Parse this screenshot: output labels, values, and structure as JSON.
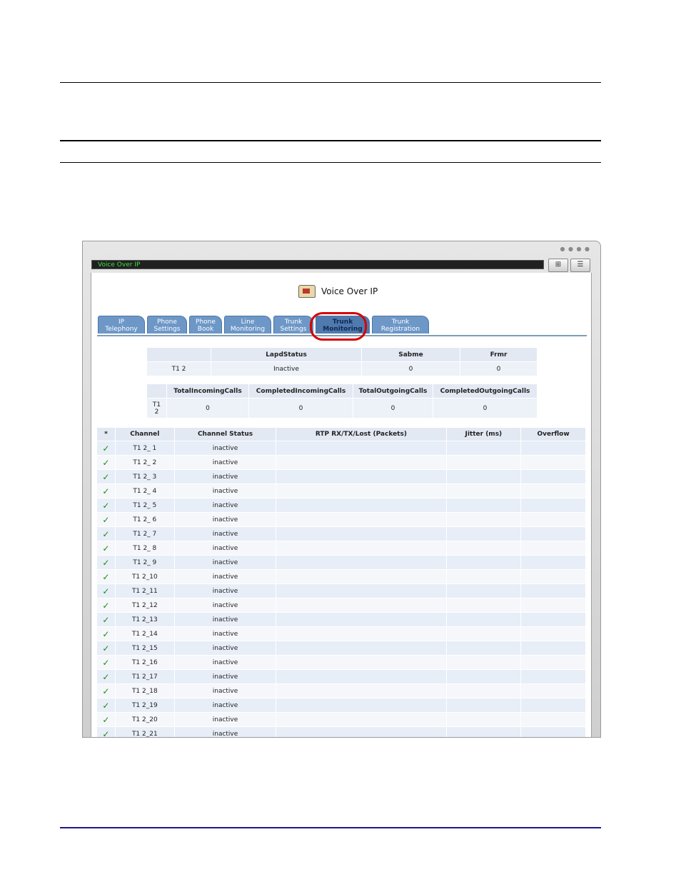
{
  "window": {
    "address": "Voice Over IP",
    "page_title": "Voice Over IP",
    "icons": [
      "phone-icon",
      "network-map-icon",
      "menu-list-icon"
    ]
  },
  "tabs": [
    {
      "line1": "IP",
      "line2": "Telephony"
    },
    {
      "line1": "Phone",
      "line2": "Settings"
    },
    {
      "line1": "Phone",
      "line2": "Book"
    },
    {
      "line1": "Line",
      "line2": "Monitoring"
    },
    {
      "line1": "Trunk",
      "line2": "Settings"
    },
    {
      "line1": "Trunk",
      "line2": "Monitoring",
      "active": true
    },
    {
      "line1": "Trunk",
      "line2": "Registration"
    }
  ],
  "status_table": {
    "headers": [
      "",
      "LapdStatus",
      "Sabme",
      "Frmr"
    ],
    "row": [
      "T1 2",
      "Inactive",
      "0",
      "0"
    ]
  },
  "calls_table": {
    "headers": [
      "",
      "TotalIncomingCalls",
      "CompletedIncomingCalls",
      "TotalOutgoingCalls",
      "CompletedOutgoingCalls"
    ],
    "row_label_1": "T1",
    "row_label_2": "2",
    "values": [
      "0",
      "0",
      "0",
      "0"
    ]
  },
  "channel_table": {
    "headers": [
      "*",
      "Channel",
      "Channel Status",
      "RTP RX/TX/Lost (Packets)",
      "Jitter (ms)",
      "Overflow"
    ],
    "check_glyph": "✓",
    "rows": [
      {
        "channel": "T1 2_ 1",
        "status": "inactive"
      },
      {
        "channel": "T1 2_ 2",
        "status": "inactive"
      },
      {
        "channel": "T1 2_ 3",
        "status": "inactive"
      },
      {
        "channel": "T1 2_ 4",
        "status": "inactive"
      },
      {
        "channel": "T1 2_ 5",
        "status": "inactive"
      },
      {
        "channel": "T1 2_ 6",
        "status": "inactive"
      },
      {
        "channel": "T1 2_ 7",
        "status": "inactive"
      },
      {
        "channel": "T1 2_ 8",
        "status": "inactive"
      },
      {
        "channel": "T1 2_ 9",
        "status": "inactive"
      },
      {
        "channel": "T1 2_10",
        "status": "inactive"
      },
      {
        "channel": "T1 2_11",
        "status": "inactive"
      },
      {
        "channel": "T1 2_12",
        "status": "inactive"
      },
      {
        "channel": "T1 2_13",
        "status": "inactive"
      },
      {
        "channel": "T1 2_14",
        "status": "inactive"
      },
      {
        "channel": "T1 2_15",
        "status": "inactive"
      },
      {
        "channel": "T1 2_16",
        "status": "inactive"
      },
      {
        "channel": "T1 2_17",
        "status": "inactive"
      },
      {
        "channel": "T1 2_18",
        "status": "inactive"
      },
      {
        "channel": "T1 2_19",
        "status": "inactive"
      },
      {
        "channel": "T1 2_20",
        "status": "inactive"
      },
      {
        "channel": "T1 2_21",
        "status": "inactive"
      }
    ]
  },
  "colors": {
    "tab": "#6d97c7",
    "tab_active": "#5079ad",
    "highlight": "#d60000",
    "check": "#1a8a1a",
    "footer_rule": "#1a1a8c"
  }
}
